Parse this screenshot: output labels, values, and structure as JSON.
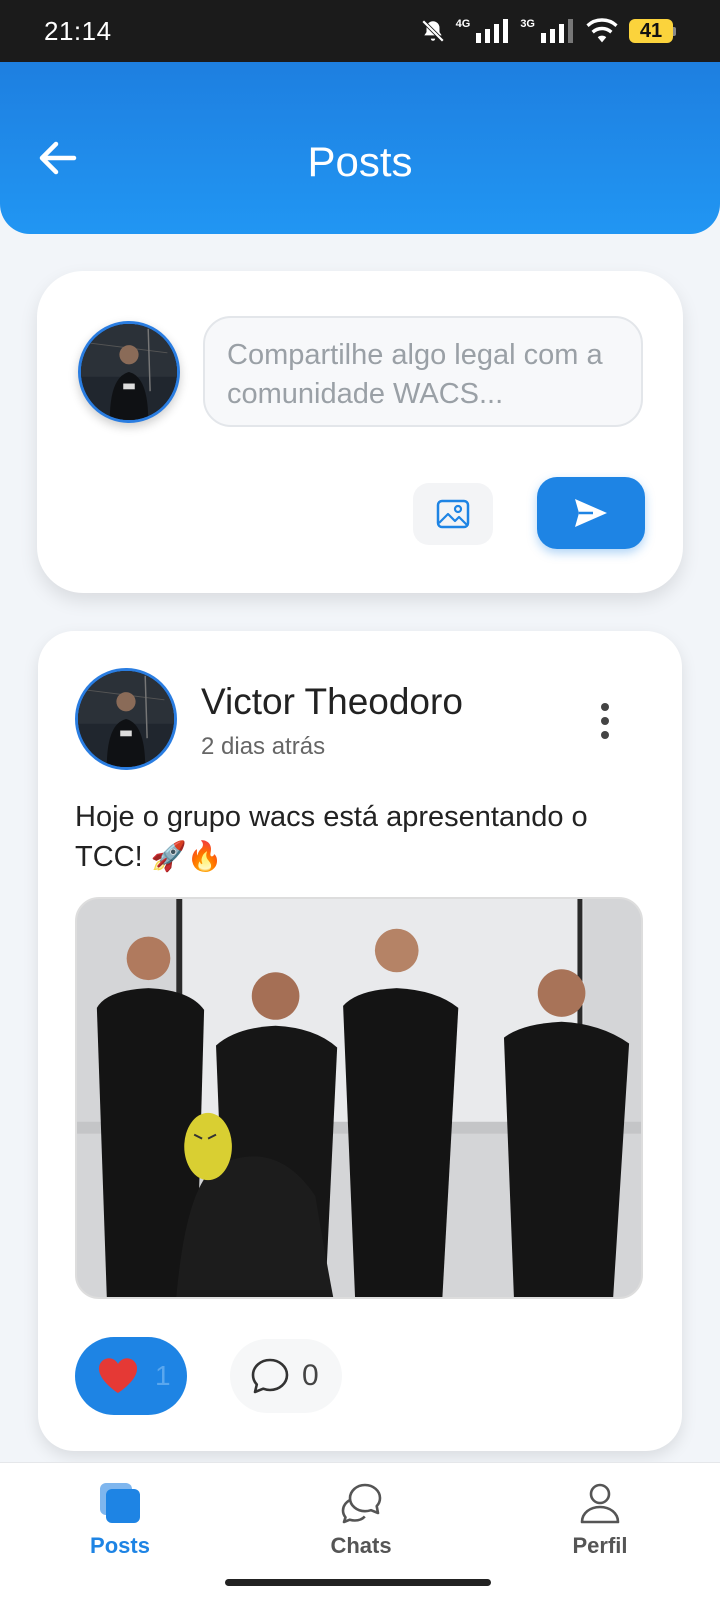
{
  "status_bar": {
    "time": "21:14",
    "network_1": "4G",
    "network_2": "3G",
    "battery": "41"
  },
  "header": {
    "title": "Posts",
    "back_icon": "arrow-left-icon"
  },
  "composer": {
    "placeholder": "Compartilhe algo legal com a comunidade WACS...",
    "image_icon": "image-icon",
    "send_icon": "send-icon"
  },
  "post": {
    "author": "Victor Theodoro",
    "time": "2 dias atrás",
    "text": "Hoje o grupo wacs está apresentando o TCC! 🚀🔥",
    "likes": "1",
    "comments": "0",
    "menu_icon": "more-vertical-icon"
  },
  "bottom_nav": {
    "items": [
      {
        "label": "Posts",
        "icon": "posts-icon",
        "active": true
      },
      {
        "label": "Chats",
        "icon": "chat-icon",
        "active": false
      },
      {
        "label": "Perfil",
        "icon": "user-icon",
        "active": false
      }
    ]
  },
  "colors": {
    "primary": "#1e84e4",
    "background": "#f2f5f9",
    "like": "#e53935"
  }
}
